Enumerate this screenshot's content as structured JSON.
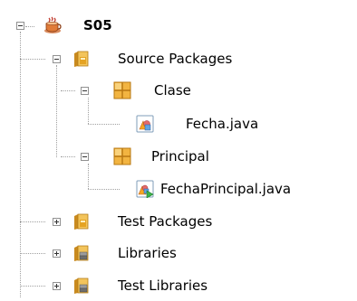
{
  "project": {
    "name": "S05",
    "expanded": true,
    "icon": "coffee-cup-project-icon",
    "children": [
      {
        "label": "Source Packages",
        "icon": "source-folder-icon",
        "expanded": true,
        "children": [
          {
            "label": "Clase",
            "icon": "package-icon",
            "expanded": true,
            "children": [
              {
                "label": "Fecha.java",
                "icon": "java-class-icon"
              }
            ]
          },
          {
            "label": "Principal",
            "icon": "package-icon",
            "expanded": true,
            "children": [
              {
                "label": "FechaPrincipal.java",
                "icon": "java-main-class-icon"
              }
            ]
          }
        ]
      },
      {
        "label": "Test Packages",
        "icon": "test-folder-icon",
        "expanded": false
      },
      {
        "label": "Libraries",
        "icon": "libraries-folder-icon",
        "expanded": false
      },
      {
        "label": "Test Libraries",
        "icon": "test-libraries-folder-icon",
        "expanded": false
      }
    ]
  },
  "colors": {
    "tree_line": "#a0a0a0",
    "folder": "#e8b54a",
    "package": "#e9a53b",
    "cup": "#c0392b"
  }
}
